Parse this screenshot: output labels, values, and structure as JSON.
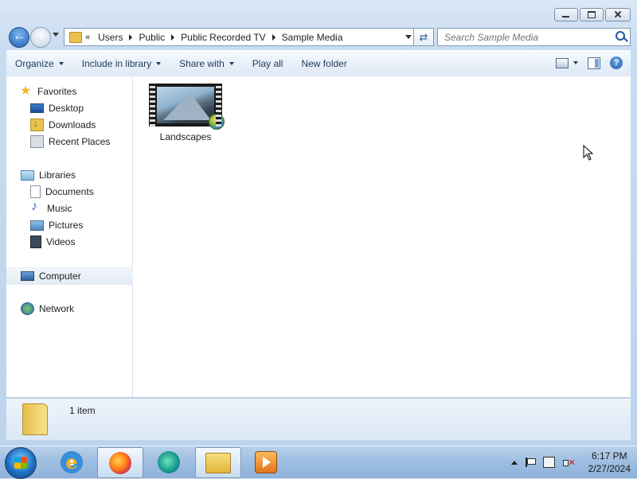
{
  "window": {
    "caption_buttons": [
      "minimize",
      "maximize",
      "close"
    ]
  },
  "navigation": {
    "breadcrumb_lead": "«",
    "breadcrumbs": [
      "Users",
      "Public",
      "Public Recorded TV",
      "Sample Media"
    ],
    "search_placeholder": "Search Sample Media"
  },
  "toolbar": {
    "organize": "Organize",
    "include_in_library": "Include in library",
    "share_with": "Share with",
    "play_all": "Play all",
    "new_folder": "New folder"
  },
  "sidebar": {
    "favorites": {
      "label": "Favorites",
      "items": [
        "Desktop",
        "Downloads",
        "Recent Places"
      ]
    },
    "libraries": {
      "label": "Libraries",
      "items": [
        "Documents",
        "Music",
        "Pictures",
        "Videos"
      ]
    },
    "computer": "Computer",
    "network": "Network"
  },
  "content": {
    "items": [
      {
        "name": "Landscapes",
        "icon": "video-folder-thumbnail"
      }
    ]
  },
  "details": {
    "item_count": "1 item"
  },
  "taskbar": {
    "apps": [
      "internet-explorer",
      "firefox",
      "edge",
      "file-explorer",
      "windows-media-player"
    ],
    "clock_time": "6:17 PM",
    "clock_date": "2/27/2024"
  }
}
